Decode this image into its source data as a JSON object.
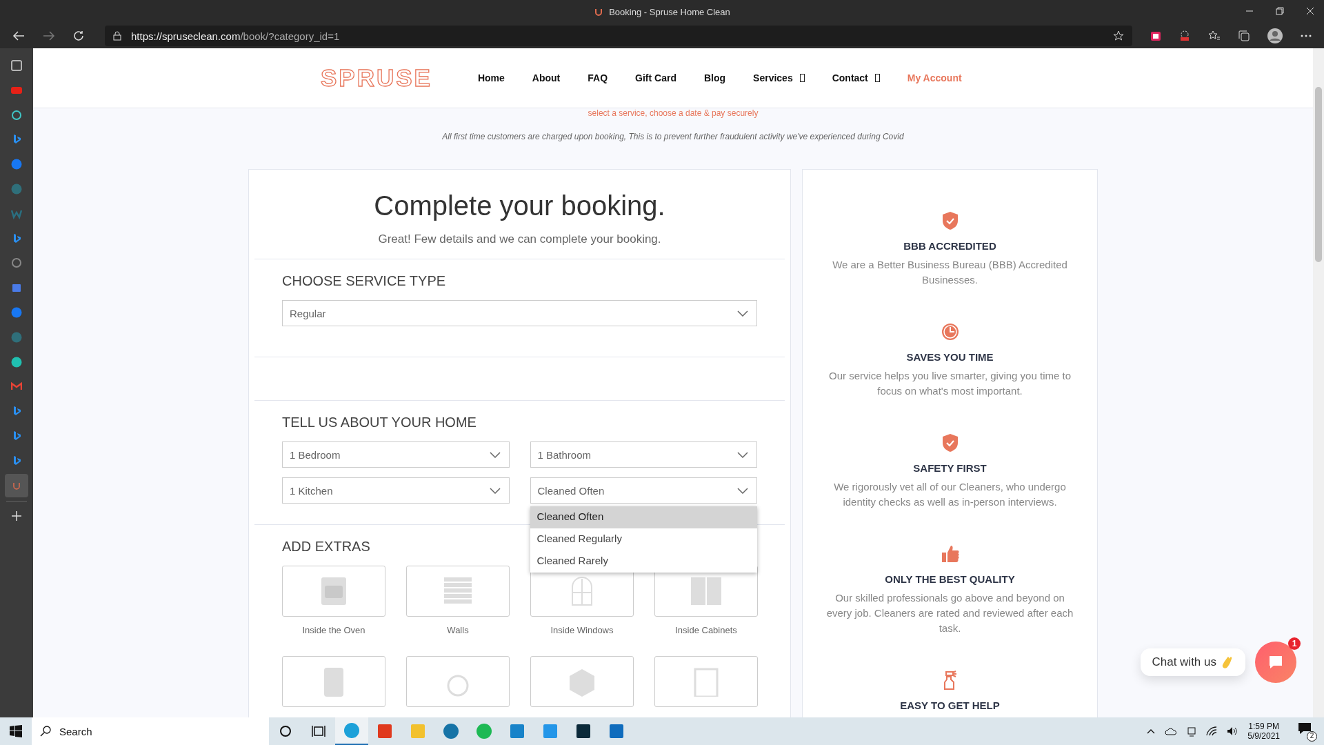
{
  "browser": {
    "tab_title": "Booking - Spruse Home Clean",
    "url_host": "https://spruseclean.com",
    "url_path": "/book/?category_id=1"
  },
  "sidebar_icons": [
    {
      "kind": "tabs",
      "selected": false
    },
    {
      "kind": "video",
      "selected": false
    },
    {
      "kind": "swirl",
      "selected": false
    },
    {
      "kind": "bing",
      "selected": false
    },
    {
      "kind": "facebook",
      "selected": false
    },
    {
      "kind": "globe",
      "selected": false
    },
    {
      "kind": "w",
      "selected": false
    },
    {
      "kind": "bing",
      "selected": false
    },
    {
      "kind": "g",
      "selected": false
    },
    {
      "kind": "store",
      "selected": false
    },
    {
      "kind": "facebook",
      "selected": false
    },
    {
      "kind": "globe",
      "selected": false
    },
    {
      "kind": "avatar",
      "selected": false
    },
    {
      "kind": "mail",
      "selected": false
    },
    {
      "kind": "bing",
      "selected": false
    },
    {
      "kind": "bing",
      "selected": false
    },
    {
      "kind": "bing",
      "selected": false
    },
    {
      "kind": "spruse",
      "selected": true
    }
  ],
  "site": {
    "logo": "SPRUSE",
    "nav": [
      {
        "label": "Home",
        "has_menu": false,
        "selected": false
      },
      {
        "label": "About",
        "has_menu": false,
        "selected": false
      },
      {
        "label": "FAQ",
        "has_menu": false,
        "selected": false
      },
      {
        "label": "Gift Card",
        "has_menu": false,
        "selected": false
      },
      {
        "label": "Blog",
        "has_menu": false,
        "selected": false
      },
      {
        "label": "Services",
        "has_menu": true,
        "selected": false
      },
      {
        "label": "Contact",
        "has_menu": true,
        "selected": false
      },
      {
        "label": "My Account",
        "has_menu": false,
        "selected": true
      }
    ]
  },
  "tagline": "select a service, choose a date & pay securely",
  "notice": "All first time customers are charged upon booking, This is to prevent further fraudulent activity we've experienced during Covid",
  "booking": {
    "title": "Complete your booking.",
    "subtitle": "Great! Few details and we can complete your booking.",
    "service_type": {
      "heading": "CHOOSE SERVICE TYPE",
      "value": "Regular"
    },
    "home": {
      "heading": "TELL US ABOUT YOUR HOME",
      "selects": [
        {
          "value": "1 Bedroom"
        },
        {
          "value": "1 Bathroom"
        },
        {
          "value": "1 Kitchen"
        },
        {
          "value": "Cleaned Often",
          "options": [
            {
              "label": "Cleaned Often",
              "selected": true
            },
            {
              "label": "Cleaned Regularly",
              "selected": false
            },
            {
              "label": "Cleaned Rarely",
              "selected": false
            }
          ]
        }
      ]
    },
    "extras": {
      "heading": "ADD EXTRAS",
      "items": [
        {
          "kind": "oven",
          "label": "Inside the Oven"
        },
        {
          "kind": "wall",
          "label": "Walls"
        },
        {
          "kind": "window",
          "label": "Inside Windows"
        },
        {
          "kind": "cabinet",
          "label": "Inside Cabinets"
        },
        {
          "kind": "fridge"
        },
        {
          "kind": "washer"
        },
        {
          "kind": "box"
        },
        {
          "kind": "dishwasher"
        }
      ]
    }
  },
  "features": [
    {
      "kind": "shield",
      "title": "BBB ACCREDITED",
      "text": "We are a Better Business Bureau (BBB) Accredited Businesses."
    },
    {
      "kind": "clock",
      "title": "SAVES YOU TIME",
      "text": "Our service helps you live smarter, giving you time to focus on what's most important."
    },
    {
      "kind": "shield",
      "title": "SAFETY FIRST",
      "text": "We rigorously vet all of our Cleaners, who undergo identity checks as well as in-person interviews."
    },
    {
      "kind": "thumb",
      "title": "ONLY THE BEST QUALITY",
      "text": "Our skilled professionals go above and beyond on every job. Cleaners are rated and reviewed after each task."
    },
    {
      "kind": "spray",
      "title": "EASY TO GET HELP"
    }
  ],
  "chat": {
    "label": "Chat with us",
    "badge": "1"
  },
  "taskbar": {
    "search_placeholder": "Search",
    "apps": [
      {
        "kind": "cortana"
      },
      {
        "kind": "taskview"
      },
      {
        "kind": "edge",
        "selected": true
      },
      {
        "kind": "office",
        "selected": false
      },
      {
        "kind": "folder",
        "selected": false
      },
      {
        "kind": "dell",
        "selected": false
      },
      {
        "kind": "music",
        "selected": false
      },
      {
        "kind": "tablet",
        "selected": false
      },
      {
        "kind": "phone",
        "selected": false
      },
      {
        "kind": "terminal",
        "selected": false
      },
      {
        "kind": "outlook",
        "selected": false
      }
    ],
    "time": "1:59 PM",
    "date": "5/9/2021",
    "notifications": "2"
  }
}
